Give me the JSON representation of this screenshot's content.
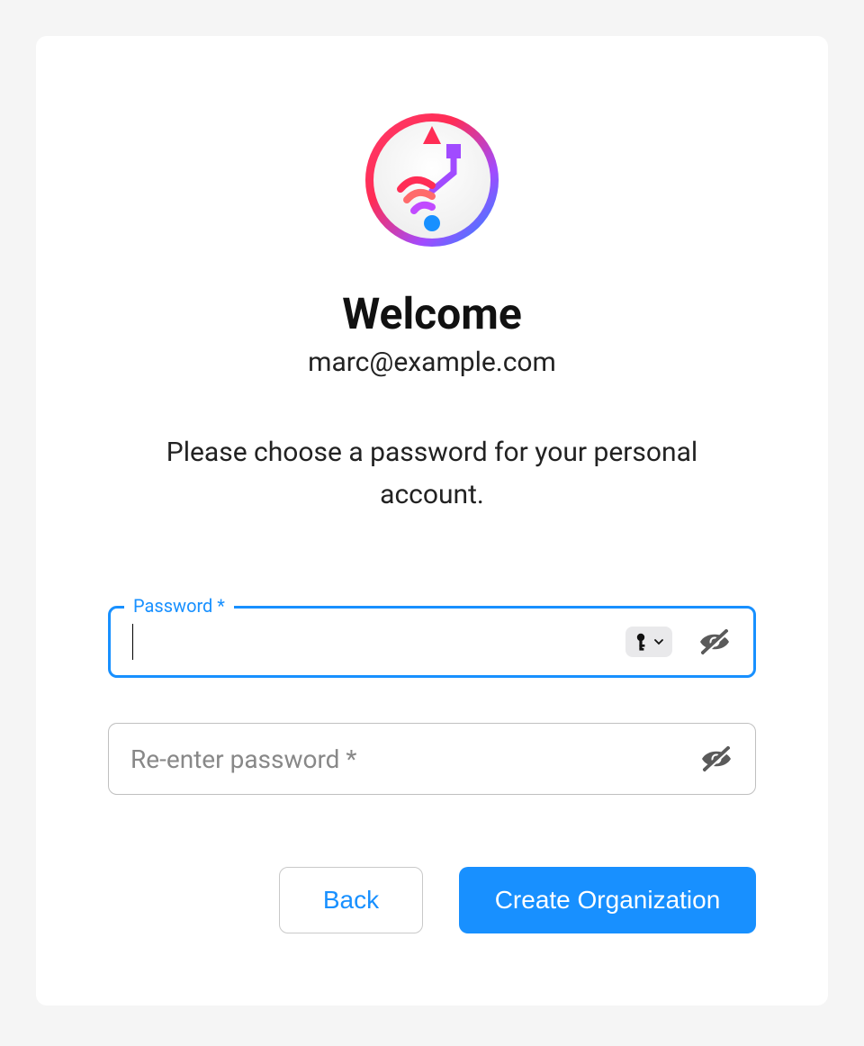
{
  "header": {
    "title": "Welcome",
    "email": "marc@example.com"
  },
  "instructions": "Please choose a password for your personal account.",
  "fields": {
    "password": {
      "label": "Password *",
      "value": ""
    },
    "confirm": {
      "placeholder": "Re-enter password *",
      "value": ""
    }
  },
  "buttons": {
    "back": "Back",
    "submit": "Create Organization"
  },
  "colors": {
    "accent": "#1890ff"
  }
}
